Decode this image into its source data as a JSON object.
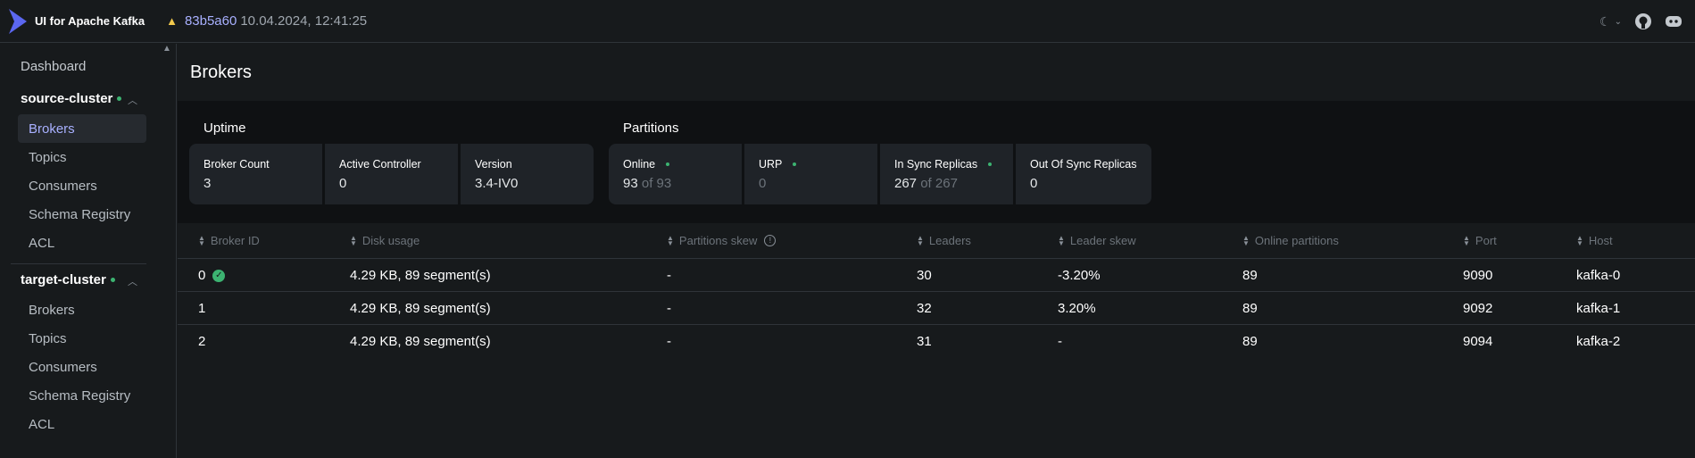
{
  "header": {
    "brand": "UI for Apache Kafka",
    "commit": "83b5a60",
    "date": "10.04.2024, 12:41:25",
    "accent": "#a8b0ff"
  },
  "sidebar": {
    "dashboard": "Dashboard",
    "clusters": [
      {
        "name": "source-cluster",
        "status": "online",
        "items": [
          "Brokers",
          "Topics",
          "Consumers",
          "Schema Registry",
          "ACL"
        ],
        "active": "Brokers"
      },
      {
        "name": "target-cluster",
        "status": "online",
        "items": [
          "Brokers",
          "Topics",
          "Consumers",
          "Schema Registry",
          "ACL"
        ]
      }
    ]
  },
  "page": {
    "title": "Brokers"
  },
  "metrics": {
    "uptime": {
      "title": "Uptime",
      "broker_count": {
        "label": "Broker Count",
        "value": "3"
      },
      "active_controller": {
        "label": "Active Controller",
        "value": "0"
      },
      "version": {
        "label": "Version",
        "value": "3.4-IV0"
      }
    },
    "partitions": {
      "title": "Partitions",
      "online": {
        "label": "Online",
        "value": "93",
        "total": "of 93"
      },
      "urp": {
        "label": "URP",
        "value": "0"
      },
      "in_sync": {
        "label": "In Sync Replicas",
        "value": "267",
        "total": "of 267"
      },
      "out_of_sync": {
        "label": "Out Of Sync Replicas",
        "value": "0"
      }
    }
  },
  "table": {
    "columns": [
      "Broker ID",
      "Disk usage",
      "Partitions skew",
      "Leaders",
      "Leader skew",
      "Online partitions",
      "Port",
      "Host"
    ],
    "rows": [
      [
        "0",
        "4.29 KB, 89 segment(s)",
        "-",
        "30",
        "-3.20%",
        "89",
        "9090",
        "kafka-0"
      ],
      [
        "1",
        "4.29 KB, 89 segment(s)",
        "-",
        "32",
        "3.20%",
        "89",
        "9092",
        "kafka-1"
      ],
      [
        "2",
        "4.29 KB, 89 segment(s)",
        "-",
        "31",
        "-",
        "89",
        "9094",
        "kafka-2"
      ]
    ]
  },
  "icons": [
    "kafka-logo-icon",
    "warning-icon",
    "moon-icon",
    "chevron-down-icon",
    "github-icon",
    "discord-icon",
    "chevron-up-icon",
    "sort-icon",
    "info-icon",
    "check-circle-icon"
  ],
  "colors": {
    "online_dot": "#3cb371",
    "warning": "#f2c94c",
    "background": "#171a1c"
  }
}
